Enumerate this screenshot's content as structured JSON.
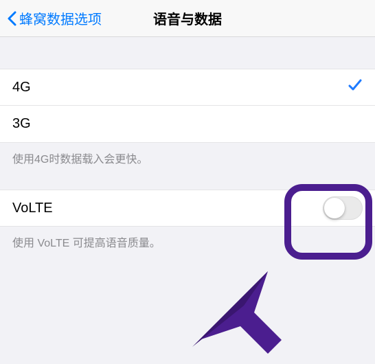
{
  "nav": {
    "back_label": "蜂窝数据选项",
    "title": "语音与数据"
  },
  "network_group": {
    "options": [
      {
        "label": "4G",
        "selected": true
      },
      {
        "label": "3G",
        "selected": false
      }
    ],
    "footer": "使用4G时数据载入会更快。"
  },
  "volte_group": {
    "label": "VoLTE",
    "enabled": false,
    "footer": "使用 VoLTE 可提高语音质量。"
  },
  "colors": {
    "tint": "#007aff",
    "highlight": "#4b1e8f"
  }
}
